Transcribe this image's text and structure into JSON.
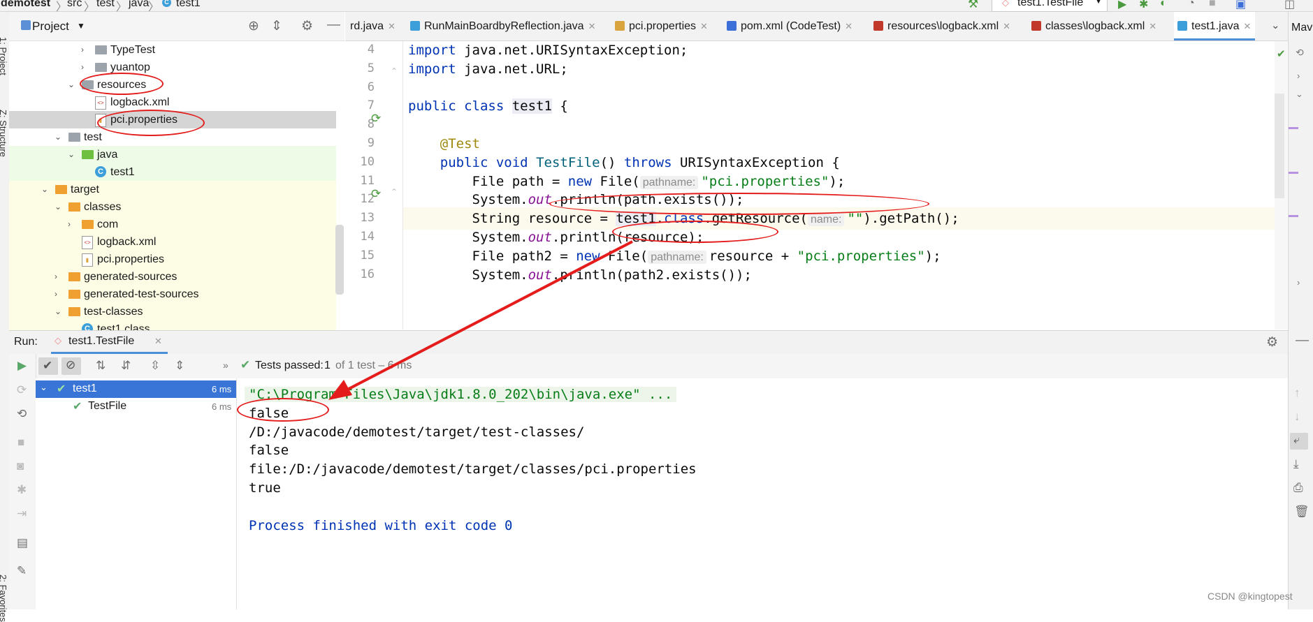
{
  "navbar": {
    "breadcrumbs": [
      "demotest",
      "src",
      "test",
      "java",
      "test1"
    ],
    "run_config": "test1.TestFile"
  },
  "left_stripe": {
    "project_label": "1: Project",
    "structure_label": "Z: Structure",
    "favorites_label": "2: Favorites"
  },
  "project_panel": {
    "title": "Project",
    "tree": [
      {
        "label": "TypeTest",
        "indent": 7,
        "arrow": "›",
        "icon": "gray"
      },
      {
        "label": "yuantop",
        "indent": 7,
        "arrow": "›",
        "icon": "gray"
      },
      {
        "label": "resources",
        "indent": 6,
        "arrow": "⌄",
        "icon": "res"
      },
      {
        "label": "logback.xml",
        "indent": 7,
        "arrow": "",
        "icon": "xml"
      },
      {
        "label": "pci.properties",
        "indent": 7,
        "arrow": "",
        "icon": "props",
        "selected": true
      },
      {
        "label": "test",
        "indent": 5,
        "arrow": "⌄",
        "icon": "gray"
      },
      {
        "label": "java",
        "indent": 6,
        "arrow": "⌄",
        "icon": "green",
        "bg": "green"
      },
      {
        "label": "test1",
        "indent": 7,
        "arrow": "",
        "icon": "class",
        "bg": "green"
      },
      {
        "label": "target",
        "indent": 4,
        "arrow": "⌄",
        "icon": "orange",
        "bg": "yellow"
      },
      {
        "label": "classes",
        "indent": 5,
        "arrow": "⌄",
        "icon": "orange",
        "bg": "yellow"
      },
      {
        "label": "com",
        "indent": 6,
        "arrow": "›",
        "icon": "orange",
        "bg": "yellow"
      },
      {
        "label": "logback.xml",
        "indent": 6,
        "arrow": "",
        "icon": "xml",
        "bg": "yellow"
      },
      {
        "label": "pci.properties",
        "indent": 6,
        "arrow": "",
        "icon": "props",
        "bg": "yellow"
      },
      {
        "label": "generated-sources",
        "indent": 5,
        "arrow": "›",
        "icon": "orange",
        "bg": "yellow"
      },
      {
        "label": "generated-test-sources",
        "indent": 5,
        "arrow": "›",
        "icon": "orange",
        "bg": "yellow"
      },
      {
        "label": "test-classes",
        "indent": 5,
        "arrow": "⌄",
        "icon": "orange",
        "bg": "yellow"
      },
      {
        "label": "test1.class",
        "indent": 6,
        "arrow": "",
        "icon": "class",
        "bg": "yellow"
      }
    ]
  },
  "editor_tabs": [
    {
      "label": "rd.java",
      "color": "#3d9fd9"
    },
    {
      "label": "RunMainBoardbyReflection.java",
      "color": "#3d9fd9"
    },
    {
      "label": "pci.properties",
      "color": "#d9a33d"
    },
    {
      "label": "pom.xml (CodeTest)",
      "color": "#3d6fd9"
    },
    {
      "label": "resources\\logback.xml",
      "color": "#c0392b"
    },
    {
      "label": "classes\\logback.xml",
      "color": "#c0392b"
    },
    {
      "label": "test1.java",
      "color": "#3d9fd9",
      "active": true
    }
  ],
  "right_stripe_label": "Mav",
  "code": {
    "line_numbers": [
      "4",
      "5",
      "6",
      "7",
      "8",
      "9",
      "10",
      "11",
      "12",
      "13",
      "14",
      "15",
      "16"
    ],
    "lines": [
      "<span class=\"kw\">import</span> java.net.URISyntaxException;",
      "<span class=\"kw\">import</span> java.net.URL;",
      "",
      "<span class=\"kw\">public class</span> <span class=\"hl\">test1</span> {",
      "",
      "    <span class=\"ann\">@Test</span>",
      "    <span class=\"kw\">public void</span> <span class=\"fn\">TestFile</span>() <span class=\"kw\">throws</span> URISyntaxException {",
      "        File path = <span class=\"kw\">new</span> File(<span class=\"hint\">pathname:</span><span class=\"str\">\"pci.properties\"</span>);",
      "        System.<span class=\"it\">out</span>.println(path.exists());",
      "        String resource = <span class=\"hl\">test1</span>.<span class=\"kw\">class</span>.getResource(<span class=\"hint\">name:</span><span class=\"str\">\"\"</span>).getPath();",
      "        System.<span class=\"it\">out</span>.println(resource);",
      "        File path2 = <span class=\"kw\">new</span> File(<span class=\"hint\">pathname:</span>resource + <span class=\"str\">\"pci.properties\"</span>);",
      "        System.<span class=\"it\">out</span>.println(path2.exists());"
    ]
  },
  "run_panel": {
    "label": "Run:",
    "tab": "test1.TestFile",
    "status_prefix": "Tests passed:",
    "status_count": "1",
    "status_rest": "of 1 test – 6 ms",
    "tests": [
      {
        "name": "test1",
        "time": "6 ms",
        "selected": true
      },
      {
        "name": "TestFile",
        "time": "6 ms"
      }
    ],
    "console": [
      "\"C:\\Program Files\\Java\\jdk1.8.0_202\\bin\\java.exe\" ...",
      "false",
      "/D:/javacode/demotest/target/test-classes/",
      "false",
      "file:/D:/javacode/demotest/target/classes/pci.properties",
      "true",
      "",
      "Process finished with exit code 0"
    ]
  },
  "watermark": "CSDN @kingtopest",
  "colors": {
    "accent": "#4a8fd8",
    "annotation": "#e41c1c",
    "selected_row": "#3875d7"
  }
}
